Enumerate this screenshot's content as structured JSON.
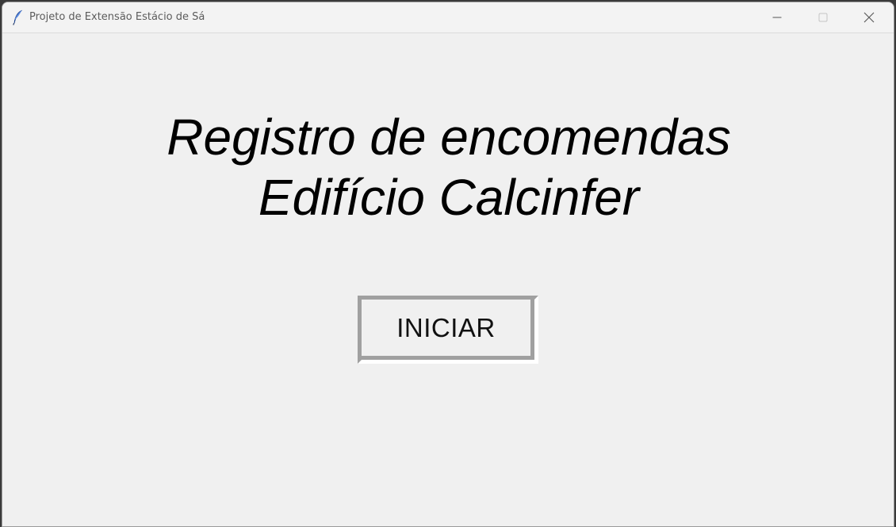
{
  "window": {
    "title": "Projeto de Extensão Estácio de Sá",
    "icon": "feather-icon",
    "controls": [
      "minimize-icon",
      "maximize-icon",
      "close-icon"
    ]
  },
  "main": {
    "heading_line1": "Registro de encomendas",
    "heading_line2": "Edifício Calcinfer",
    "start_button_label": "INICIAR"
  },
  "colors": {
    "background": "#f0f0f0",
    "text": "#000000",
    "button_border": "#a0a0a0"
  }
}
